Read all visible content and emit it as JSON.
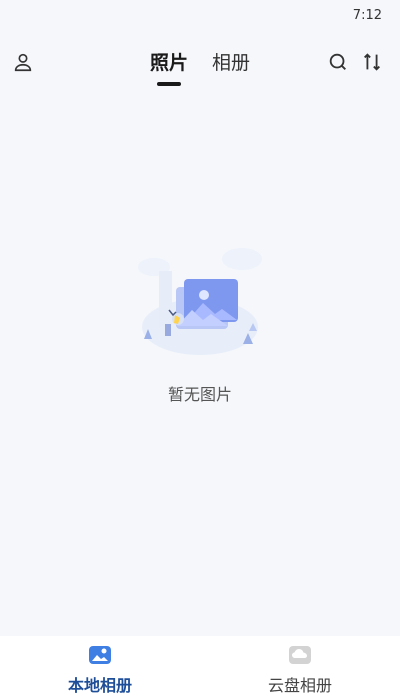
{
  "status_bar": {
    "time": "7:12"
  },
  "header": {
    "tabs": [
      {
        "label": "照片",
        "active": true
      },
      {
        "label": "相册",
        "active": false
      }
    ],
    "icons": {
      "left": "user-icon",
      "search": "search-icon",
      "sort": "sort-icon"
    }
  },
  "empty_state": {
    "message": "暂无图片",
    "illustration": "empty-photos-illustration"
  },
  "bottom_nav": {
    "items": [
      {
        "label": "本地相册",
        "icon": "local-album-icon",
        "active": true
      },
      {
        "label": "云盘相册",
        "icon": "cloud-album-icon",
        "active": false
      }
    ]
  },
  "colors": {
    "background": "#f5f7fb",
    "accent": "#1f4e98",
    "illustration_blue": "#7f98ef"
  }
}
